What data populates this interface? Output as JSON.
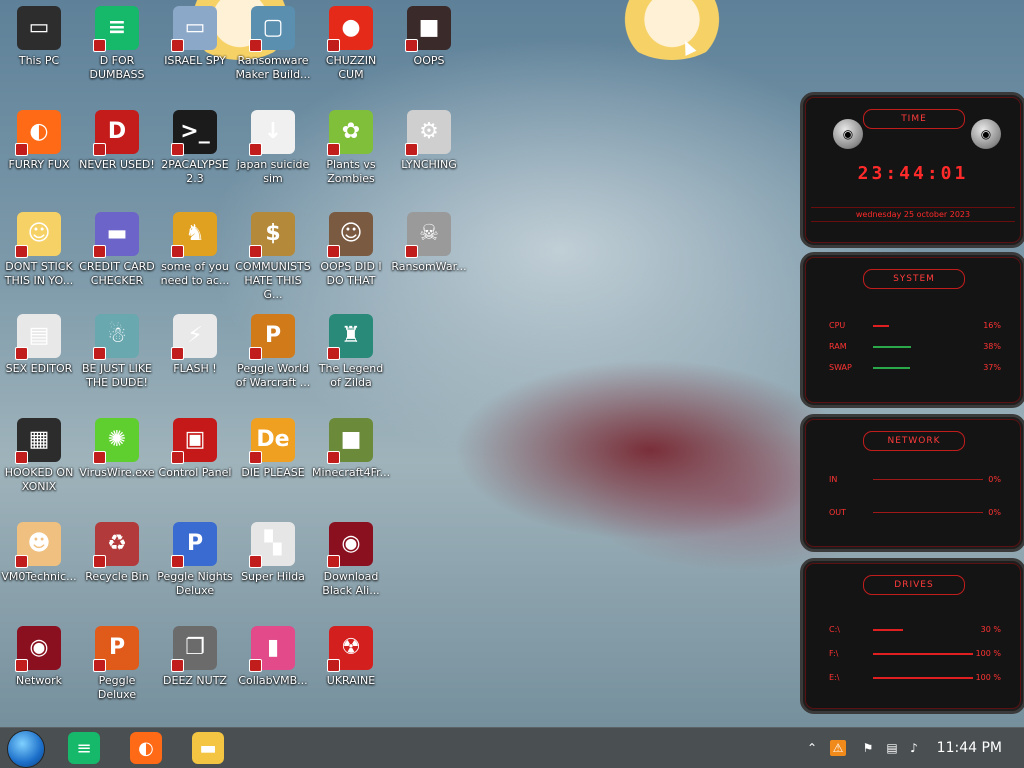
{
  "desktop": {
    "icons": [
      {
        "label": "This PC",
        "icon": "computer-icon",
        "color": "#2d2d2d"
      },
      {
        "label": "FURRY FUX",
        "icon": "firefox-icon",
        "color": "#ff6a16"
      },
      {
        "label": "DONT STICK THIS IN YO...",
        "icon": "anime-face-icon",
        "color": "#f6d266"
      },
      {
        "label": "SEX EDITOR",
        "icon": "document-icon",
        "color": "#e8e8e8"
      },
      {
        "label": "HOOKED ON XONIX",
        "icon": "xonix-game-icon",
        "color": "#2c2c2c"
      },
      {
        "label": "VM0Technic...",
        "icon": "doctor-icon",
        "color": "#f0c080"
      },
      {
        "label": "Network",
        "icon": "alien-orb-icon",
        "color": "#8a1020"
      },
      {
        "label": "D FOR DUMBASS",
        "icon": "chat-bubble-icon",
        "color": "#16b86a"
      },
      {
        "label": "NEVER USED!",
        "icon": "devcpp-icon",
        "color": "#c41b1b"
      },
      {
        "label": "CREDIT CARD CHECKER",
        "icon": "credit-card-icon",
        "color": "#6c64c8"
      },
      {
        "label": "BE JUST LIKE THE DUDE!",
        "icon": "santa-icon",
        "color": "#6aa8b0"
      },
      {
        "label": "VirusWire.exe",
        "icon": "lime-icon",
        "color": "#5fcf2f"
      },
      {
        "label": "Recycle Bin",
        "icon": "recycle-bin-icon",
        "color": "#b33a3a"
      },
      {
        "label": "Peggle Deluxe",
        "icon": "peggle-icon",
        "color": "#e05a1a"
      },
      {
        "label": "ISRAEL SPY",
        "icon": "network-pc-icon",
        "color": "#8ca8c8"
      },
      {
        "label": "2PACALYPSE 2.3",
        "icon": "terminal-icon",
        "color": "#1b1b1b"
      },
      {
        "label": "some of you need to ac...",
        "icon": "dog-icon",
        "color": "#e0a020"
      },
      {
        "label": "FLASH !",
        "icon": "flash-icon",
        "color": "#e9e9e9"
      },
      {
        "label": "Control Panel",
        "icon": "control-panel-icon",
        "color": "#c51818"
      },
      {
        "label": "Peggle Nights Deluxe",
        "icon": "peggle-nights-icon",
        "color": "#3a6bd0"
      },
      {
        "label": "DEEZ NUTZ",
        "icon": "stacked-windows-icon",
        "color": "#6b6b6b"
      },
      {
        "label": "Ransomware Maker Build...",
        "icon": "app-window-icon",
        "color": "#5a8fb0"
      },
      {
        "label": "japan suicide sim",
        "icon": "japan-sim-icon",
        "color": "#f0f0f0"
      },
      {
        "label": "COMMUNISTS HATE THIS G...",
        "icon": "money-bag-icon",
        "color": "#b48a3a"
      },
      {
        "label": "Peggle World of Warcraft ...",
        "icon": "peggle-wow-icon",
        "color": "#d07a1a"
      },
      {
        "label": "DIE PLEASE",
        "icon": "de-logo-icon",
        "color": "#f0a020"
      },
      {
        "label": "Super Hilda",
        "icon": "pixel-cat-icon",
        "color": "#e6e6e6"
      },
      {
        "label": "CollabVMB...",
        "icon": "pink-monitor-icon",
        "color": "#e24a8a"
      },
      {
        "label": "CHUZZIN CUM",
        "icon": "chuzzle-icon",
        "color": "#e52a1a"
      },
      {
        "label": "Plants vs Zombies",
        "icon": "plant-icon",
        "color": "#7fbf3a"
      },
      {
        "label": "OOPS DID I DO THAT",
        "icon": "portrait-icon",
        "color": "#7a5a40"
      },
      {
        "label": "The Legend of Zilda",
        "icon": "pixel-hero-icon",
        "color": "#2a8a7a"
      },
      {
        "label": "Minecraft4Fr...",
        "icon": "grass-block-icon",
        "color": "#6b8a3a"
      },
      {
        "label": "Download Black Ali...",
        "icon": "alien-orb-icon",
        "color": "#8a1020"
      },
      {
        "label": "UKRAINE",
        "icon": "radiation-icon",
        "color": "#d41f1f"
      },
      {
        "label": "OOPS",
        "icon": "dark-box-icon",
        "color": "#3a2a2a"
      },
      {
        "label": "LYNCHING",
        "icon": "lynch-icon",
        "color": "#cfcfcf"
      },
      {
        "label": "RansomWar...",
        "icon": "skull-ring-icon",
        "color": "#9a9a9a"
      }
    ]
  },
  "widget": {
    "time_title": "TIME",
    "time": "23:44:01",
    "date": "wednesday 25 october 2023",
    "system_title": "SYSTEM",
    "system_rows": [
      {
        "name": "CPU",
        "value": "16%",
        "level": 0.16
      },
      {
        "name": "RAM",
        "value": "38%",
        "level": 0.38
      },
      {
        "name": "SWAP",
        "value": "37%",
        "level": 0.37
      }
    ],
    "network_title": "NETWORK",
    "network_rows": [
      {
        "name": "IN",
        "value": "0%"
      },
      {
        "name": "OUT",
        "value": "0%"
      }
    ],
    "drives_title": "DRIVES",
    "drives_rows": [
      {
        "name": "C:\\",
        "value": "30 %",
        "level": 0.3
      },
      {
        "name": "F:\\",
        "value": "100 %",
        "level": 1.0
      },
      {
        "name": "E:\\",
        "value": "100 %",
        "level": 1.0
      }
    ]
  },
  "taskbar": {
    "clock": "11:44 PM",
    "apps": [
      {
        "icon": "chat-bubble-icon",
        "color": "#16b86a"
      },
      {
        "icon": "firefox-icon",
        "color": "#ff6a16"
      },
      {
        "icon": "file-explorer-icon",
        "color": "#f4c542"
      }
    ],
    "tray": [
      "warning-icon",
      "flag-icon",
      "network-icon",
      "volume-icon"
    ]
  }
}
